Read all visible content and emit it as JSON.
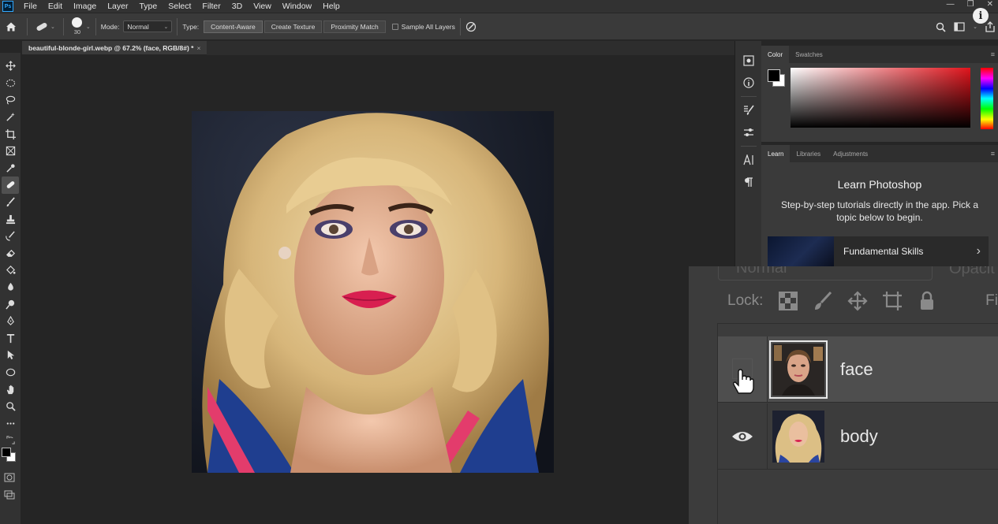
{
  "menubar": {
    "items": [
      "File",
      "Edit",
      "Image",
      "Layer",
      "Type",
      "Select",
      "Filter",
      "3D",
      "View",
      "Window",
      "Help"
    ],
    "app_icon": "Ps"
  },
  "options": {
    "brush_size": "30",
    "mode_label": "Mode:",
    "mode_value": "Normal",
    "type_label": "Type:",
    "type_buttons": [
      "Content-Aware",
      "Create Texture",
      "Proximity Match"
    ],
    "sample_all_layers": "Sample All Layers"
  },
  "document": {
    "tab_title": "beautiful-blonde-girl.webp @ 67.2% (face, RGB/8#) *",
    "close_symbol": "×"
  },
  "color_panel": {
    "tabs": [
      "Color",
      "Swatches"
    ],
    "foreground": "#000000",
    "background": "#ffffff",
    "hue_color": "#e0141c"
  },
  "learn_panel": {
    "tabs": [
      "Learn",
      "Libraries",
      "Adjustments"
    ],
    "title": "Learn Photoshop",
    "description": "Step-by-step tutorials directly in the app. Pick a topic below to begin.",
    "card_label": "Fundamental Skills"
  },
  "layers_panel": {
    "blend_mode": "Normal",
    "opacity_label": "Opacit",
    "lock_label": "Lock:",
    "fill_label": "Fi",
    "layers": [
      {
        "name": "face",
        "selected": true,
        "visible": false
      },
      {
        "name": "body",
        "selected": false,
        "visible": true
      }
    ]
  }
}
